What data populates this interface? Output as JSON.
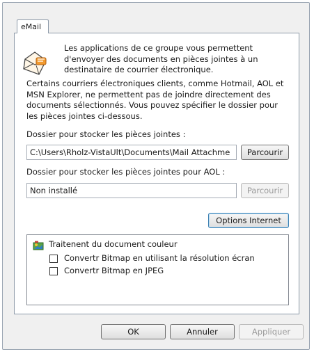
{
  "tab": {
    "label": "eMail"
  },
  "intro_text": "Les applications de ce groupe vous permettent d'envoyer des documents en pièces jointes à un destinataire de courrier électronique.",
  "description_text": "Certains courriers électroniques clients, comme Hotmail, AOL et MSN Explorer, ne permettent pas de joindre directement des documents sélectionnés. Vous pouvez spécifier le dossier pour les pièces jointes ci-dessous.",
  "attachments_folder": {
    "label": "Dossier pour stocker les pièces jointes :",
    "value": "C:\\Users\\Rholz-VistaUlt\\Documents\\Mail Attachme",
    "browse_label": "Parcourir"
  },
  "aol_folder": {
    "label": "Dossier pour stocker les pièces jointes pour AOL :",
    "value": "Non installé",
    "browse_label": "Parcourir"
  },
  "options_button": "Options Internet",
  "processing": {
    "title": "Traitenent du document couleur",
    "options": [
      {
        "label": "Convertr Bitmap en utilisant la résolution écran",
        "checked": false
      },
      {
        "label": "Convertr Bitmap en JPEG",
        "checked": false
      }
    ]
  },
  "footer": {
    "ok": "OK",
    "cancel": "Annuler",
    "apply": "Appliquer"
  },
  "icons": {
    "mail": "mail-envelope-icon",
    "tree": "color-document-icon"
  }
}
